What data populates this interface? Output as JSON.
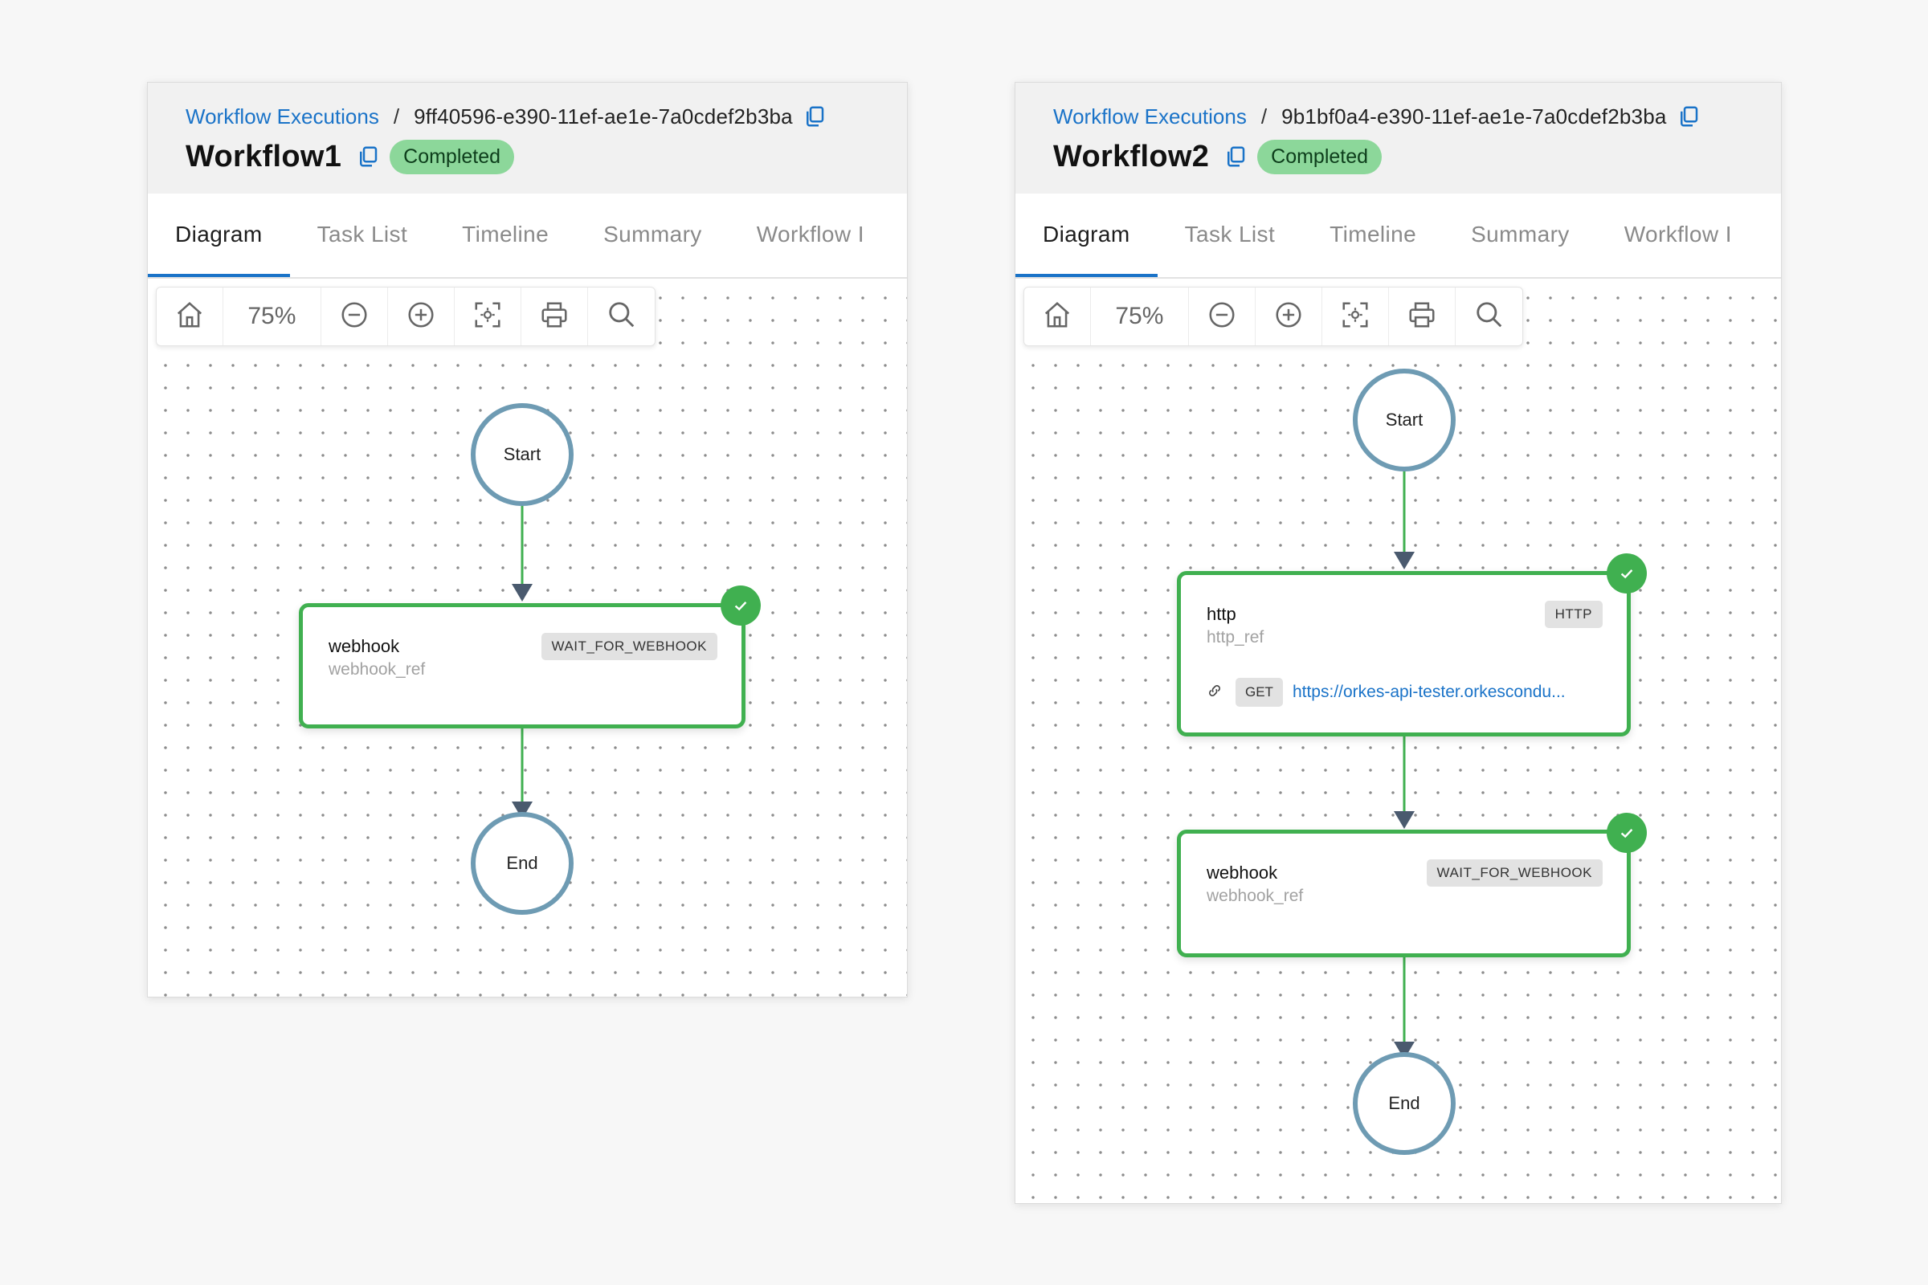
{
  "panels": [
    {
      "breadcrumb": {
        "link": "Workflow Executions",
        "separator": "/",
        "execution_id": "9ff40596-e390-11ef-ae1e-7a0cdef2b3ba"
      },
      "title": "Workflow1",
      "status": "Completed",
      "tabs": [
        "Diagram",
        "Task List",
        "Timeline",
        "Summary",
        "Workflow I"
      ],
      "toolbar": {
        "zoom": "75%",
        "icons": [
          "home-icon",
          "zoom-out-icon",
          "zoom-in-icon",
          "fit-to-screen-icon",
          "print-icon",
          "search-icon"
        ]
      },
      "diagram": {
        "start_label": "Start",
        "end_label": "End",
        "tasks": [
          {
            "name": "webhook",
            "ref": "webhook_ref",
            "type": "WAIT_FOR_WEBHOOK",
            "status": "completed"
          }
        ]
      }
    },
    {
      "breadcrumb": {
        "link": "Workflow Executions",
        "separator": "/",
        "execution_id": "9b1bf0a4-e390-11ef-ae1e-7a0cdef2b3ba"
      },
      "title": "Workflow2",
      "status": "Completed",
      "tabs": [
        "Diagram",
        "Task List",
        "Timeline",
        "Summary",
        "Workflow I"
      ],
      "toolbar": {
        "zoom": "75%",
        "icons": [
          "home-icon",
          "zoom-out-icon",
          "zoom-in-icon",
          "fit-to-screen-icon",
          "print-icon",
          "search-icon"
        ]
      },
      "diagram": {
        "start_label": "Start",
        "end_label": "End",
        "tasks": [
          {
            "name": "http",
            "ref": "http_ref",
            "type": "HTTP",
            "method": "GET",
            "url": "https://orkes-api-tester.orkescondu...",
            "status": "completed"
          },
          {
            "name": "webhook",
            "ref": "webhook_ref",
            "type": "WAIT_FOR_WEBHOOK",
            "status": "completed"
          }
        ]
      }
    }
  ],
  "colors": {
    "accent": "#1a73c8",
    "success": "#40b050",
    "badge_bg": "#8cd79a",
    "node_border": "#6e9bb3",
    "arrow": "#4a5a6e"
  }
}
